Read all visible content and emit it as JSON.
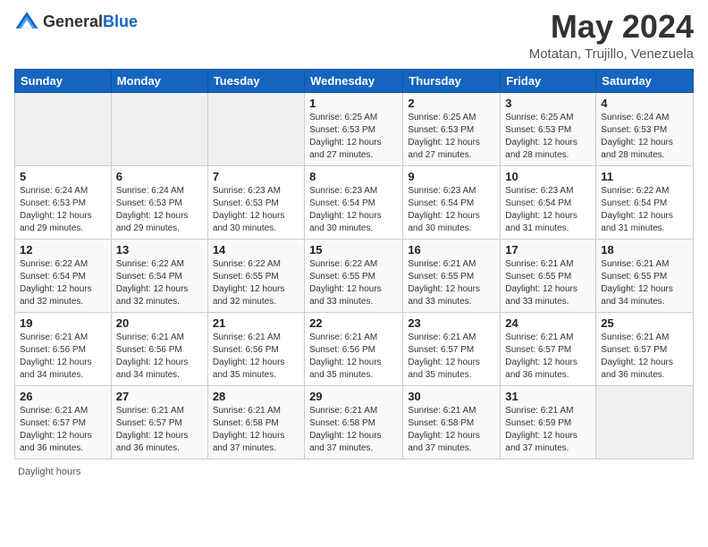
{
  "header": {
    "logo_general": "General",
    "logo_blue": "Blue",
    "month_title": "May 2024",
    "location": "Motatan, Trujillo, Venezuela"
  },
  "days_of_week": [
    "Sunday",
    "Monday",
    "Tuesday",
    "Wednesday",
    "Thursday",
    "Friday",
    "Saturday"
  ],
  "weeks": [
    [
      {
        "day": "",
        "info": ""
      },
      {
        "day": "",
        "info": ""
      },
      {
        "day": "",
        "info": ""
      },
      {
        "day": "1",
        "info": "Sunrise: 6:25 AM\nSunset: 6:53 PM\nDaylight: 12 hours and 27 minutes."
      },
      {
        "day": "2",
        "info": "Sunrise: 6:25 AM\nSunset: 6:53 PM\nDaylight: 12 hours and 27 minutes."
      },
      {
        "day": "3",
        "info": "Sunrise: 6:25 AM\nSunset: 6:53 PM\nDaylight: 12 hours and 28 minutes."
      },
      {
        "day": "4",
        "info": "Sunrise: 6:24 AM\nSunset: 6:53 PM\nDaylight: 12 hours and 28 minutes."
      }
    ],
    [
      {
        "day": "5",
        "info": "Sunrise: 6:24 AM\nSunset: 6:53 PM\nDaylight: 12 hours and 29 minutes."
      },
      {
        "day": "6",
        "info": "Sunrise: 6:24 AM\nSunset: 6:53 PM\nDaylight: 12 hours and 29 minutes."
      },
      {
        "day": "7",
        "info": "Sunrise: 6:23 AM\nSunset: 6:53 PM\nDaylight: 12 hours and 30 minutes."
      },
      {
        "day": "8",
        "info": "Sunrise: 6:23 AM\nSunset: 6:54 PM\nDaylight: 12 hours and 30 minutes."
      },
      {
        "day": "9",
        "info": "Sunrise: 6:23 AM\nSunset: 6:54 PM\nDaylight: 12 hours and 30 minutes."
      },
      {
        "day": "10",
        "info": "Sunrise: 6:23 AM\nSunset: 6:54 PM\nDaylight: 12 hours and 31 minutes."
      },
      {
        "day": "11",
        "info": "Sunrise: 6:22 AM\nSunset: 6:54 PM\nDaylight: 12 hours and 31 minutes."
      }
    ],
    [
      {
        "day": "12",
        "info": "Sunrise: 6:22 AM\nSunset: 6:54 PM\nDaylight: 12 hours and 32 minutes."
      },
      {
        "day": "13",
        "info": "Sunrise: 6:22 AM\nSunset: 6:54 PM\nDaylight: 12 hours and 32 minutes."
      },
      {
        "day": "14",
        "info": "Sunrise: 6:22 AM\nSunset: 6:55 PM\nDaylight: 12 hours and 32 minutes."
      },
      {
        "day": "15",
        "info": "Sunrise: 6:22 AM\nSunset: 6:55 PM\nDaylight: 12 hours and 33 minutes."
      },
      {
        "day": "16",
        "info": "Sunrise: 6:21 AM\nSunset: 6:55 PM\nDaylight: 12 hours and 33 minutes."
      },
      {
        "day": "17",
        "info": "Sunrise: 6:21 AM\nSunset: 6:55 PM\nDaylight: 12 hours and 33 minutes."
      },
      {
        "day": "18",
        "info": "Sunrise: 6:21 AM\nSunset: 6:55 PM\nDaylight: 12 hours and 34 minutes."
      }
    ],
    [
      {
        "day": "19",
        "info": "Sunrise: 6:21 AM\nSunset: 6:56 PM\nDaylight: 12 hours and 34 minutes."
      },
      {
        "day": "20",
        "info": "Sunrise: 6:21 AM\nSunset: 6:56 PM\nDaylight: 12 hours and 34 minutes."
      },
      {
        "day": "21",
        "info": "Sunrise: 6:21 AM\nSunset: 6:56 PM\nDaylight: 12 hours and 35 minutes."
      },
      {
        "day": "22",
        "info": "Sunrise: 6:21 AM\nSunset: 6:56 PM\nDaylight: 12 hours and 35 minutes."
      },
      {
        "day": "23",
        "info": "Sunrise: 6:21 AM\nSunset: 6:57 PM\nDaylight: 12 hours and 35 minutes."
      },
      {
        "day": "24",
        "info": "Sunrise: 6:21 AM\nSunset: 6:57 PM\nDaylight: 12 hours and 36 minutes."
      },
      {
        "day": "25",
        "info": "Sunrise: 6:21 AM\nSunset: 6:57 PM\nDaylight: 12 hours and 36 minutes."
      }
    ],
    [
      {
        "day": "26",
        "info": "Sunrise: 6:21 AM\nSunset: 6:57 PM\nDaylight: 12 hours and 36 minutes."
      },
      {
        "day": "27",
        "info": "Sunrise: 6:21 AM\nSunset: 6:57 PM\nDaylight: 12 hours and 36 minutes."
      },
      {
        "day": "28",
        "info": "Sunrise: 6:21 AM\nSunset: 6:58 PM\nDaylight: 12 hours and 37 minutes."
      },
      {
        "day": "29",
        "info": "Sunrise: 6:21 AM\nSunset: 6:58 PM\nDaylight: 12 hours and 37 minutes."
      },
      {
        "day": "30",
        "info": "Sunrise: 6:21 AM\nSunset: 6:58 PM\nDaylight: 12 hours and 37 minutes."
      },
      {
        "day": "31",
        "info": "Sunrise: 6:21 AM\nSunset: 6:59 PM\nDaylight: 12 hours and 37 minutes."
      },
      {
        "day": "",
        "info": ""
      }
    ]
  ],
  "footer": {
    "daylight_hours_label": "Daylight hours"
  }
}
